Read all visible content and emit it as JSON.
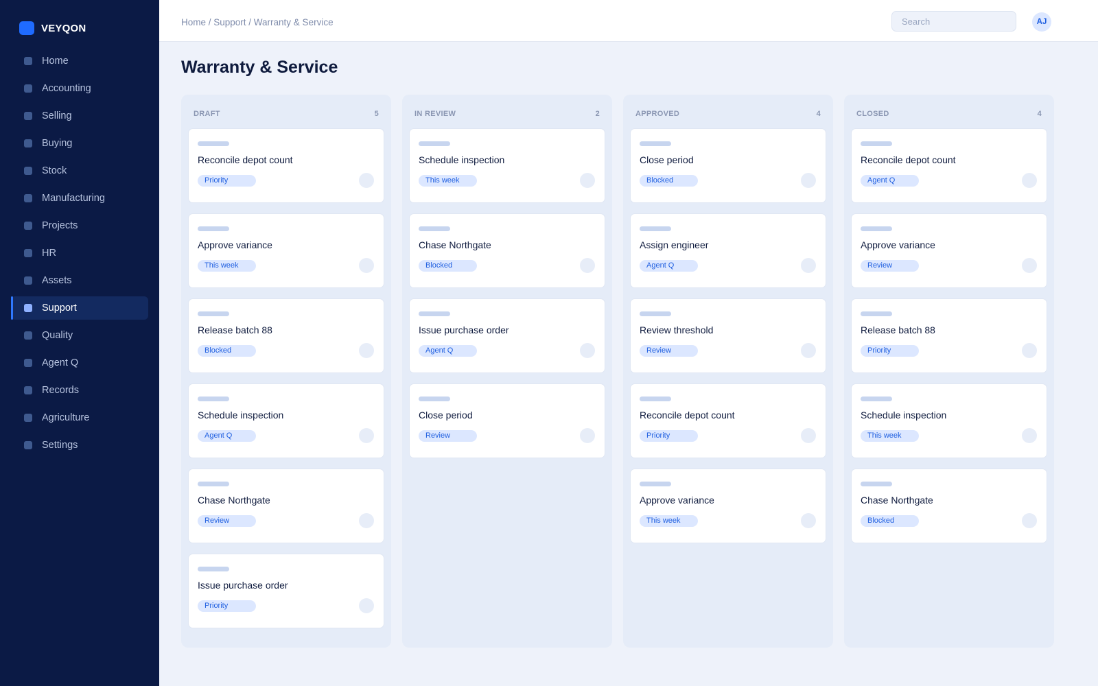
{
  "brand": {
    "name": "VEYQON"
  },
  "sidebar": {
    "items": [
      {
        "label": "Home",
        "name": "home"
      },
      {
        "label": "Accounting",
        "name": "accounting"
      },
      {
        "label": "Selling",
        "name": "selling"
      },
      {
        "label": "Buying",
        "name": "buying"
      },
      {
        "label": "Stock",
        "name": "stock"
      },
      {
        "label": "Manufacturing",
        "name": "manufacturing"
      },
      {
        "label": "Projects",
        "name": "projects"
      },
      {
        "label": "HR",
        "name": "hr"
      },
      {
        "label": "Assets",
        "name": "assets"
      },
      {
        "label": "Support",
        "name": "support",
        "active": true
      },
      {
        "label": "Quality",
        "name": "quality"
      },
      {
        "label": "Agent Q",
        "name": "agent-q"
      },
      {
        "label": "Records",
        "name": "records"
      },
      {
        "label": "Agriculture",
        "name": "agriculture"
      },
      {
        "label": "Settings",
        "name": "settings"
      }
    ]
  },
  "header": {
    "breadcrumb": "Home / Support / Warranty & Service",
    "search_placeholder": "Search",
    "avatar_initials": "AJ"
  },
  "page": {
    "title": "Warranty & Service"
  },
  "colors": {
    "accent": "#1f6bff",
    "sidebar": "#0b1a45",
    "tag_bg": "#dce7ff",
    "tag_text": "#1f5fe0"
  },
  "board": {
    "columns": [
      {
        "name": "DRAFT",
        "count": "5",
        "cards": [
          {
            "title": "Reconcile depot count",
            "tag": "Priority"
          },
          {
            "title": "Approve variance",
            "tag": "This week"
          },
          {
            "title": "Release batch 88",
            "tag": "Blocked"
          },
          {
            "title": "Schedule inspection",
            "tag": "Agent Q"
          },
          {
            "title": "Chase Northgate",
            "tag": "Review"
          },
          {
            "title": "Issue purchase order",
            "tag": "Priority"
          }
        ]
      },
      {
        "name": "IN REVIEW",
        "count": "2",
        "cards": [
          {
            "title": "Schedule inspection",
            "tag": "This week"
          },
          {
            "title": "Chase Northgate",
            "tag": "Blocked"
          },
          {
            "title": "Issue purchase order",
            "tag": "Agent Q"
          },
          {
            "title": "Close period",
            "tag": "Review"
          }
        ]
      },
      {
        "name": "APPROVED",
        "count": "4",
        "cards": [
          {
            "title": "Close period",
            "tag": "Blocked"
          },
          {
            "title": "Assign engineer",
            "tag": "Agent Q"
          },
          {
            "title": "Review threshold",
            "tag": "Review"
          },
          {
            "title": "Reconcile depot count",
            "tag": "Priority"
          },
          {
            "title": "Approve variance",
            "tag": "This week"
          }
        ]
      },
      {
        "name": "CLOSED",
        "count": "4",
        "cards": [
          {
            "title": "Reconcile depot count",
            "tag": "Agent Q"
          },
          {
            "title": "Approve variance",
            "tag": "Review"
          },
          {
            "title": "Release batch 88",
            "tag": "Priority"
          },
          {
            "title": "Schedule inspection",
            "tag": "This week"
          },
          {
            "title": "Chase Northgate",
            "tag": "Blocked"
          }
        ]
      }
    ]
  }
}
